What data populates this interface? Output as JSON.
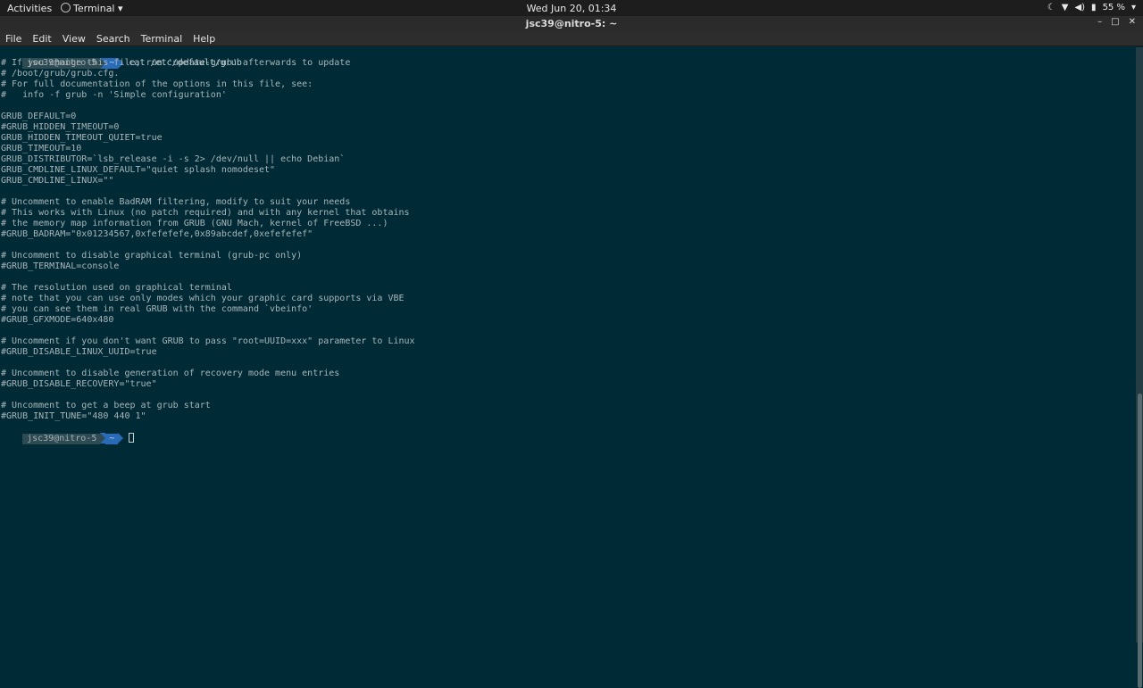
{
  "topbar": {
    "activities": "Activities",
    "app_menu": "Terminal",
    "clock": "Wed Jun 20, 01:34",
    "battery": "55 %"
  },
  "window": {
    "title": "jsc39@nitro-5: ~"
  },
  "menubar": {
    "items": [
      "File",
      "Edit",
      "View",
      "Search",
      "Terminal",
      "Help"
    ]
  },
  "terminal": {
    "prompt_user": "jsc39@nitro-5",
    "prompt_dir": "~",
    "command": "cat /etc/default/grub",
    "output": [
      "# If you change this file, run 'update-grub' afterwards to update",
      "# /boot/grub/grub.cfg.",
      "# For full documentation of the options in this file, see:",
      "#   info -f grub -n 'Simple configuration'",
      "",
      "GRUB_DEFAULT=0",
      "#GRUB_HIDDEN_TIMEOUT=0",
      "GRUB_HIDDEN_TIMEOUT_QUIET=true",
      "GRUB_TIMEOUT=10",
      "GRUB_DISTRIBUTOR=`lsb_release -i -s 2> /dev/null || echo Debian`",
      "GRUB_CMDLINE_LINUX_DEFAULT=\"quiet splash nomodeset\"",
      "GRUB_CMDLINE_LINUX=\"\"",
      "",
      "# Uncomment to enable BadRAM filtering, modify to suit your needs",
      "# This works with Linux (no patch required) and with any kernel that obtains",
      "# the memory map information from GRUB (GNU Mach, kernel of FreeBSD ...)",
      "#GRUB_BADRAM=\"0x01234567,0xfefefefe,0x89abcdef,0xefefefef\"",
      "",
      "# Uncomment to disable graphical terminal (grub-pc only)",
      "#GRUB_TERMINAL=console",
      "",
      "# The resolution used on graphical terminal",
      "# note that you can use only modes which your graphic card supports via VBE",
      "# you can see them in real GRUB with the command `vbeinfo'",
      "#GRUB_GFXMODE=640x480",
      "",
      "# Uncomment if you don't want GRUB to pass \"root=UUID=xxx\" parameter to Linux",
      "#GRUB_DISABLE_LINUX_UUID=true",
      "",
      "# Uncomment to disable generation of recovery mode menu entries",
      "#GRUB_DISABLE_RECOVERY=\"true\"",
      "",
      "# Uncomment to get a beep at grub start",
      "#GRUB_INIT_TUNE=\"480 440 1\""
    ]
  }
}
